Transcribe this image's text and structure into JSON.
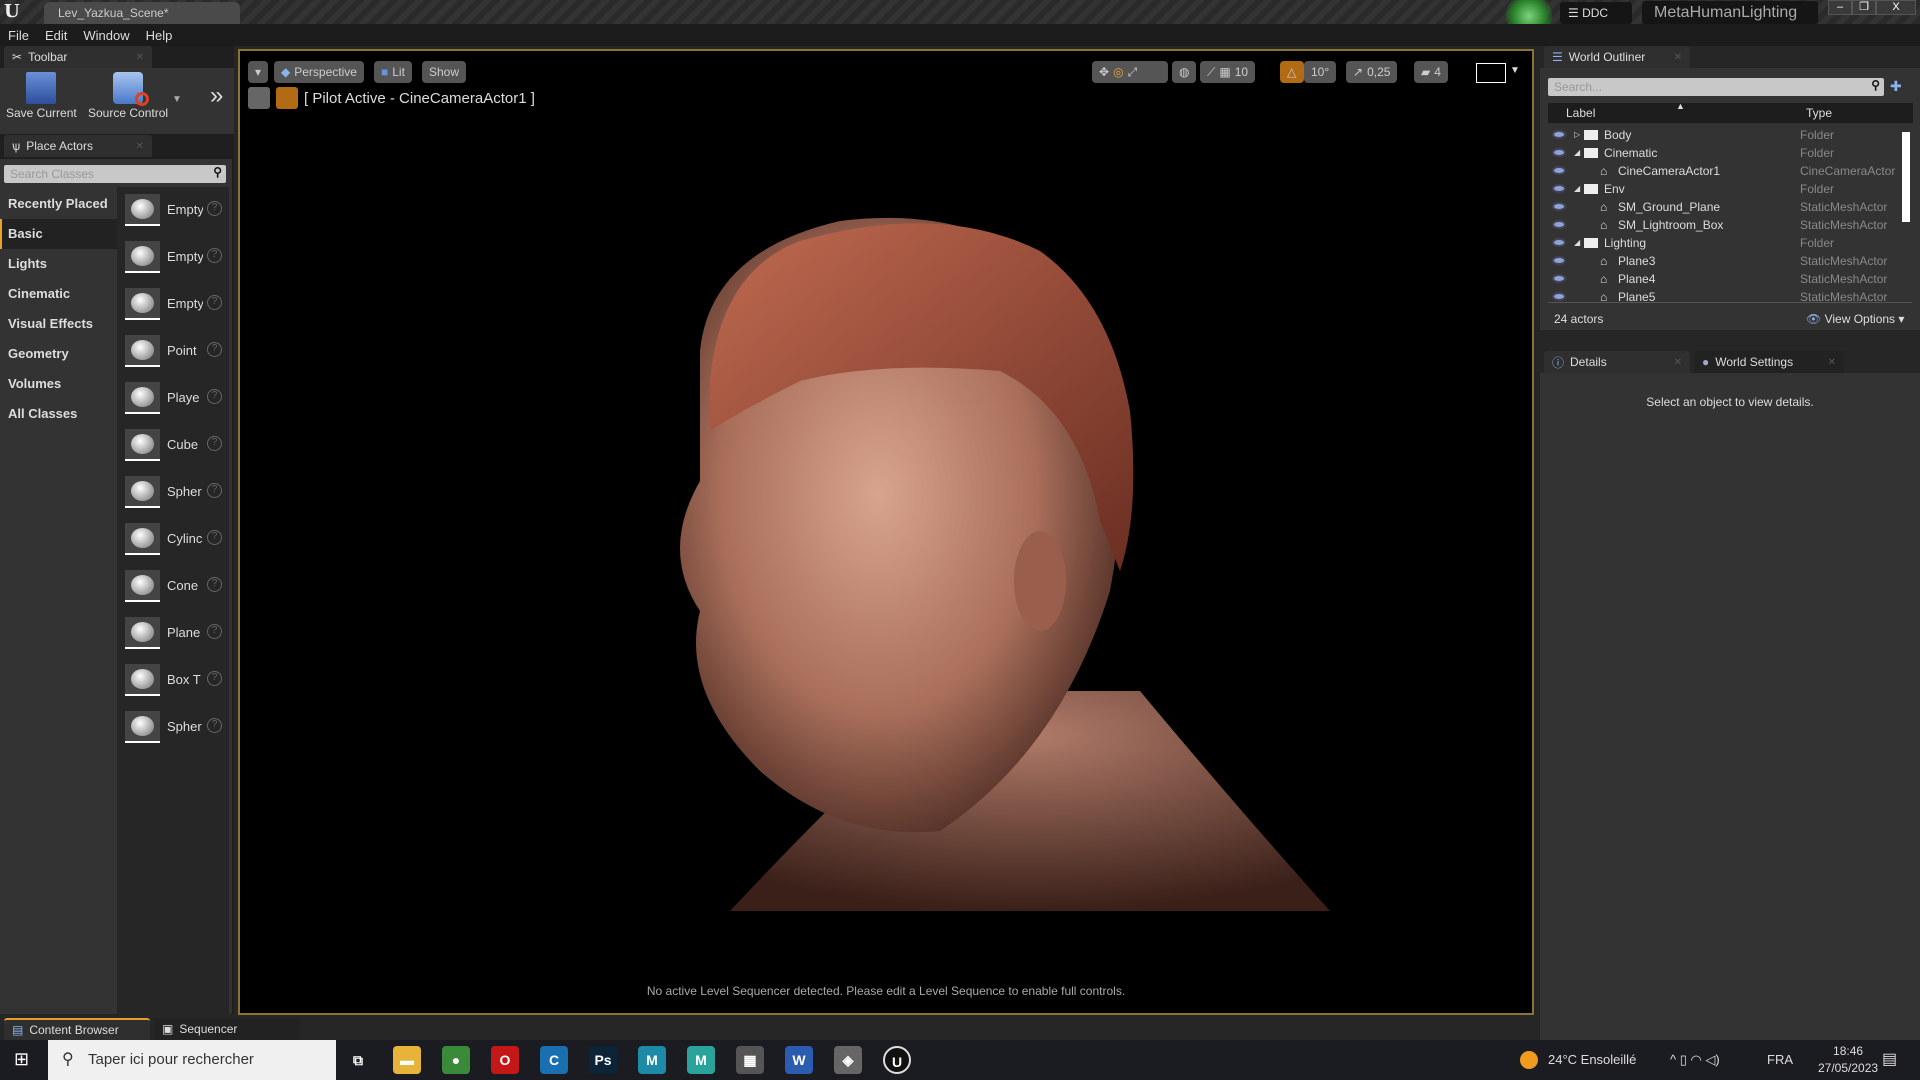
{
  "window": {
    "doc_tab": "Lev_Yazkua_Scene*",
    "ddc": "DDC",
    "project": "MetaHumanLighting",
    "minimize": "–",
    "restore": "❐",
    "close": "X"
  },
  "menu": [
    "File",
    "Edit",
    "Window",
    "Help"
  ],
  "toolbar": {
    "tab": "Toolbar",
    "save": "Save Current",
    "source": "Source Control",
    "more": "»"
  },
  "place_actors": {
    "tab": "Place Actors",
    "search_placeholder": "Search Classes",
    "categories": [
      "Recently Placed",
      "Basic",
      "Lights",
      "Cinematic",
      "Visual Effects",
      "Geometry",
      "Volumes",
      "All Classes"
    ],
    "items": [
      "Empty",
      "Empty",
      "Empty",
      "Point",
      "Playe",
      "Cube",
      "Spher",
      "Cylinc",
      "Cone",
      "Plane",
      "Box T",
      "Spher"
    ]
  },
  "viewport": {
    "dropdown": "▾",
    "perspective": "Perspective",
    "lit": "Lit",
    "show": "Show",
    "grid_snap": "10",
    "rot_snap": "10°",
    "scale_snap": "0,25",
    "cam_speed": "4",
    "pilot": "[ Pilot Active - CineCameraActor1 ]",
    "sequencer_msg": "No active Level Sequencer detected. Please edit a Level Sequence to enable full controls."
  },
  "outliner": {
    "tab": "World Outliner",
    "search_placeholder": "Search...",
    "col_label": "Label",
    "col_type": "Type",
    "rows": [
      {
        "label": "Body",
        "type": "Folder",
        "depth": 0,
        "folder": true,
        "arrow": "▷"
      },
      {
        "label": "Cinematic",
        "type": "Folder",
        "depth": 0,
        "folder": true,
        "arrow": "◢"
      },
      {
        "label": "CineCameraActor1",
        "type": "CineCameraActor",
        "depth": 1,
        "folder": false
      },
      {
        "label": "Env",
        "type": "Folder",
        "depth": 0,
        "folder": true,
        "arrow": "◢"
      },
      {
        "label": "SM_Ground_Plane",
        "type": "StaticMeshActor",
        "depth": 1,
        "folder": false
      },
      {
        "label": "SM_Lightroom_Box",
        "type": "StaticMeshActor",
        "depth": 1,
        "folder": false
      },
      {
        "label": "Lighting",
        "type": "Folder",
        "depth": 0,
        "folder": true,
        "arrow": "◢"
      },
      {
        "label": "Plane3",
        "type": "StaticMeshActor",
        "depth": 1,
        "folder": false
      },
      {
        "label": "Plane4",
        "type": "StaticMeshActor",
        "depth": 1,
        "folder": false
      },
      {
        "label": "Plane5",
        "type": "StaticMeshActor",
        "depth": 1,
        "folder": false
      }
    ],
    "count": "24 actors",
    "view_options": "View Options"
  },
  "details": {
    "tab": "Details",
    "world_settings_tab": "World Settings",
    "empty_msg": "Select an object to view details."
  },
  "bottom_tabs": [
    "Content Browser",
    "Sequencer"
  ],
  "taskbar": {
    "search": "Taper ici pour rechercher",
    "weather": "24°C  Ensoleillé",
    "lang": "FRA",
    "time": "18:46",
    "date": "27/05/2023",
    "apps": [
      {
        "name": "task-view",
        "glyph": "⧉",
        "color": "transparent"
      },
      {
        "name": "file-explorer",
        "glyph": "▬",
        "color": "#e8b339"
      },
      {
        "name": "chrome",
        "glyph": "●",
        "color": "#3a8a3a"
      },
      {
        "name": "opera",
        "glyph": "O",
        "color": "#c41818"
      },
      {
        "name": "ccleaner",
        "glyph": "C",
        "color": "#1a6fb0"
      },
      {
        "name": "photoshop",
        "glyph": "Ps",
        "color": "#0d2438"
      },
      {
        "name": "maya",
        "glyph": "M",
        "color": "#1d8aa8"
      },
      {
        "name": "maya-lt",
        "glyph": "M",
        "color": "#2aa39a"
      },
      {
        "name": "calculator",
        "glyph": "▦",
        "color": "#555"
      },
      {
        "name": "word",
        "glyph": "W",
        "color": "#2b5cb0"
      },
      {
        "name": "app",
        "glyph": "◈",
        "color": "#666"
      },
      {
        "name": "unreal",
        "glyph": "U",
        "color": "#111"
      }
    ]
  },
  "colors": {
    "accent": "#e5a12a",
    "orange": "#b26a14",
    "viewport_border": "#8a7434"
  }
}
